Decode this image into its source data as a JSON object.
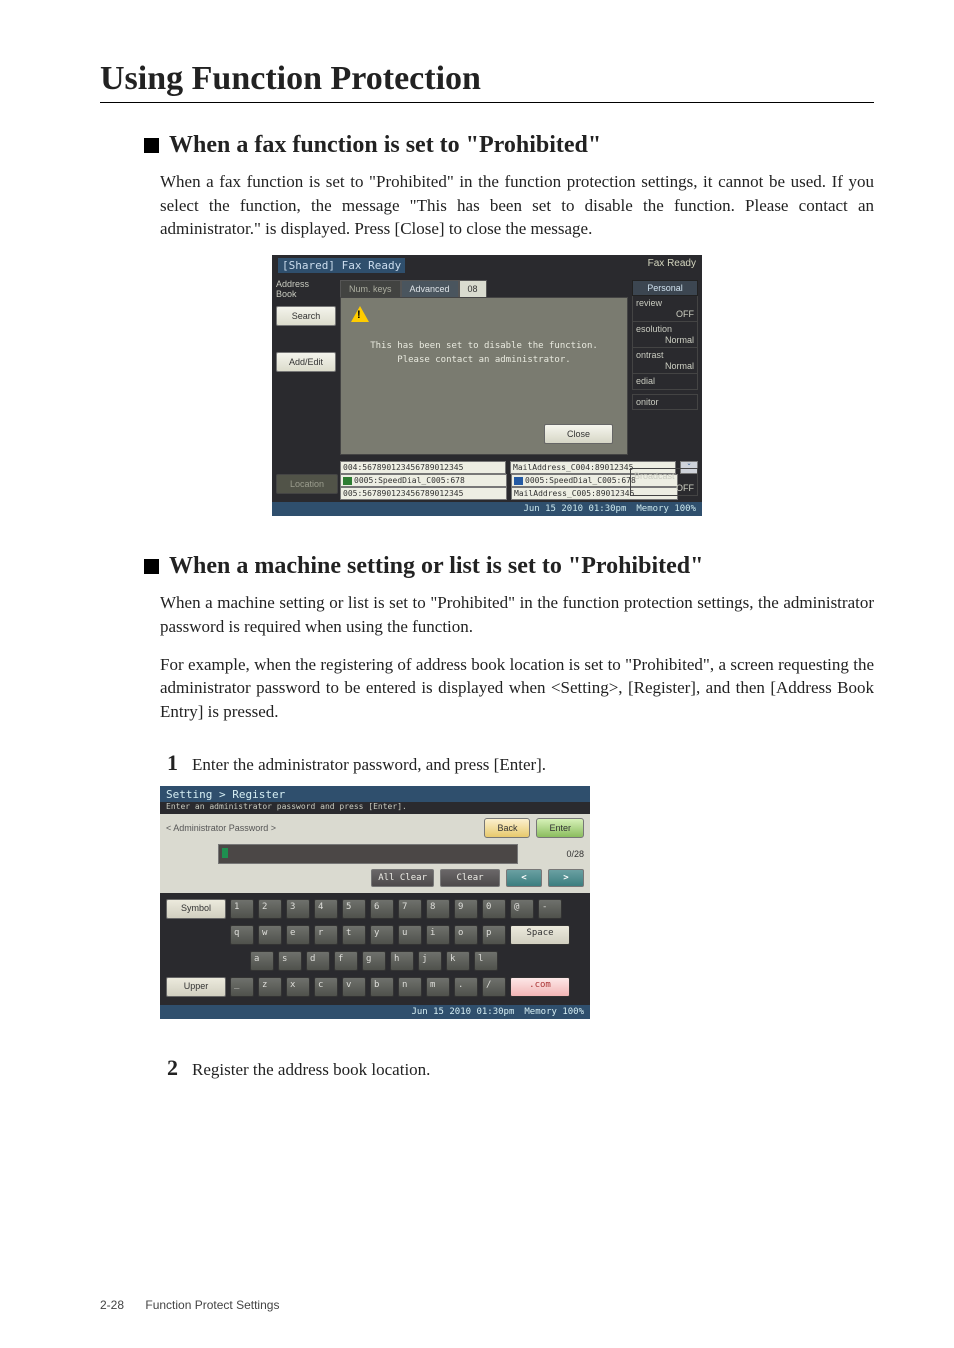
{
  "page": {
    "title": "Using Function Protection",
    "footer_page": "2-28",
    "footer_section": "Function Protect Settings"
  },
  "section1": {
    "heading": "When a fax function is set to \"Prohibited\"",
    "paragraph": "When a fax function is set to \"Prohibited\" in the function protection settings, it cannot be used. If you select the function, the message \"This has been set to disable the function. Please contact an administrator.\" is displayed. Press [Close] to close the message."
  },
  "section2": {
    "heading": "When a machine setting or list is set to \"Prohibited\"",
    "paragraph1": "When a machine setting or list is set to \"Prohibited\" in the function protection settings, the administrator password is required when using the function.",
    "paragraph2": "For example, when the registering of address book location is set to \"Prohibited\", a screen requesting the administrator password to be entered is displayed when <Setting>, [Register], and then [Address Book Entry] is pressed.",
    "step1_num": "1",
    "step1_text": "Enter the administrator password, and press [Enter].",
    "step2_num": "2",
    "step2_text": "Register the address book location."
  },
  "ss1": {
    "title": "[Shared] Fax Ready",
    "badge": "Fax Ready",
    "left": {
      "addressbook": "Address\nBook",
      "search": "Search",
      "addedit": "Add/Edit",
      "location": "Location"
    },
    "tabs": {
      "numkeys": "Num. keys",
      "advanced": "Advanced",
      "count": "08"
    },
    "dialog": {
      "msg": "This has been set to disable the function.\nPlease contact an administrator.",
      "close": "Close"
    },
    "right": {
      "personal": "Personal",
      "items": [
        {
          "label": "review",
          "value": "OFF"
        },
        {
          "label": "esolution",
          "value": "Normal"
        },
        {
          "label": "ontrast",
          "value": "Normal"
        },
        {
          "label": "edial",
          "value": ""
        }
      ],
      "monitor": "onitor",
      "broadcast": {
        "label": "Broadcast",
        "value": "OFF"
      }
    },
    "list": {
      "rows": [
        {
          "a": "004:567890123456789012345",
          "b": "MailAddress_C004:89012345",
          "ia": "",
          "ib": ""
        },
        {
          "a": "0005:SpeedDial_C005:678",
          "b": "0005:SpeedDial_C005:678",
          "ia": "g",
          "ib": "b"
        },
        {
          "a": "005:567890123456789012345",
          "b": "MailAddress_C005:89012345",
          "ia": "",
          "ib": ""
        }
      ],
      "scroll": "ˇ"
    },
    "foot": {
      "time": "Jun 15 2010 01:30pm",
      "mem": "Memory  100%"
    }
  },
  "ss2": {
    "title": "Setting > Register",
    "subtitle": "Enter an administrator password and press [Enter].",
    "label": "< Administrator Password >",
    "back": "Back",
    "enter": "Enter",
    "counter": "0/28",
    "allclear": "All Clear",
    "clear": "Clear",
    "arrow_l": "<",
    "arrow_r": ">",
    "symbol": "Symbol",
    "upper": "Upper",
    "space": "Space",
    "com": ".com",
    "rows": {
      "r1": [
        "1",
        "2",
        "3",
        "4",
        "5",
        "6",
        "7",
        "8",
        "9",
        "0",
        "@",
        "-"
      ],
      "r2": [
        "q",
        "w",
        "e",
        "r",
        "t",
        "y",
        "u",
        "i",
        "o",
        "p"
      ],
      "r3": [
        "a",
        "s",
        "d",
        "f",
        "g",
        "h",
        "j",
        "k",
        "l"
      ],
      "r4": [
        "_",
        "z",
        "x",
        "c",
        "v",
        "b",
        "n",
        "m",
        ".",
        "/"
      ]
    },
    "foot": {
      "time": "Jun 15 2010 01:30pm",
      "mem": "Memory  100%"
    }
  }
}
